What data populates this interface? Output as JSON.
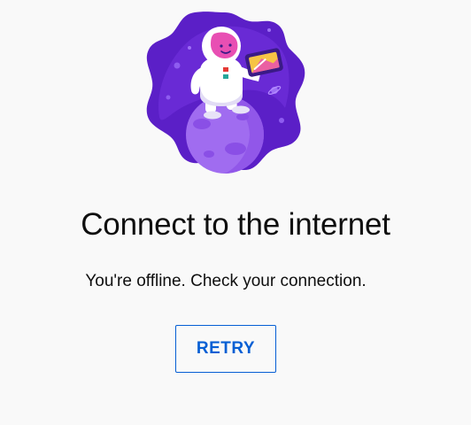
{
  "illustration": {
    "icon": "astronaut-on-planet-illustration",
    "colors": {
      "blob_dark": "#5b1fc7",
      "blob_mid": "#7b3fe4",
      "planet": "#a06cf0",
      "planet_crater": "#8a4fe6",
      "suit": "#ffffff",
      "visor": "#e84fb3",
      "tablet_frame": "#3a1a86",
      "tablet_screen": "#f6c445"
    }
  },
  "main": {
    "title": "Connect to the internet",
    "subtitle": "You're offline. Check your connection."
  },
  "actions": {
    "retry_label": "RETRY",
    "accent_color": "#065fd4"
  }
}
